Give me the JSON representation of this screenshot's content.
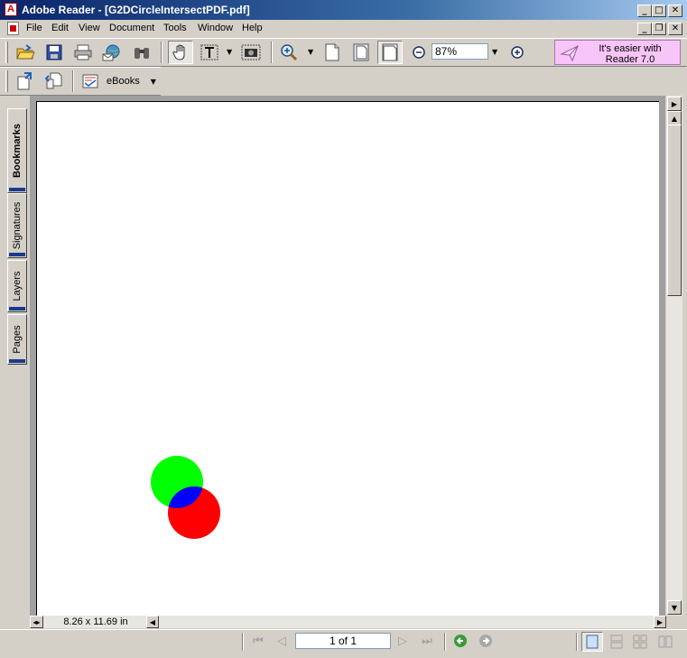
{
  "window": {
    "title": "Adobe Reader - [G2DCircleIntersectPDF.pdf]",
    "app_icon_letter": "A"
  },
  "menu": [
    "File",
    "Edit",
    "View",
    "Document",
    "Tools",
    "Window",
    "Help"
  ],
  "toolbar": {
    "zoom_value": "87%",
    "ebooks_label": "eBooks",
    "promo_line1": "It's easier with",
    "promo_line2": "Reader 7.0"
  },
  "sidebar": {
    "tabs": [
      "Bookmarks",
      "Signatures",
      "Layers",
      "Pages"
    ]
  },
  "document": {
    "page_size": "8.26 x 11.69 in",
    "shapes": [
      {
        "name": "green-circle",
        "color": "#00ff00"
      },
      {
        "name": "red-circle",
        "color": "#ff0000"
      },
      {
        "name": "intersection",
        "color": "#0000ff"
      }
    ]
  },
  "status": {
    "page_indicator": "1 of 1"
  },
  "colors": {
    "accent": "#0a246a",
    "promo_bg": "#f7c5f7"
  }
}
